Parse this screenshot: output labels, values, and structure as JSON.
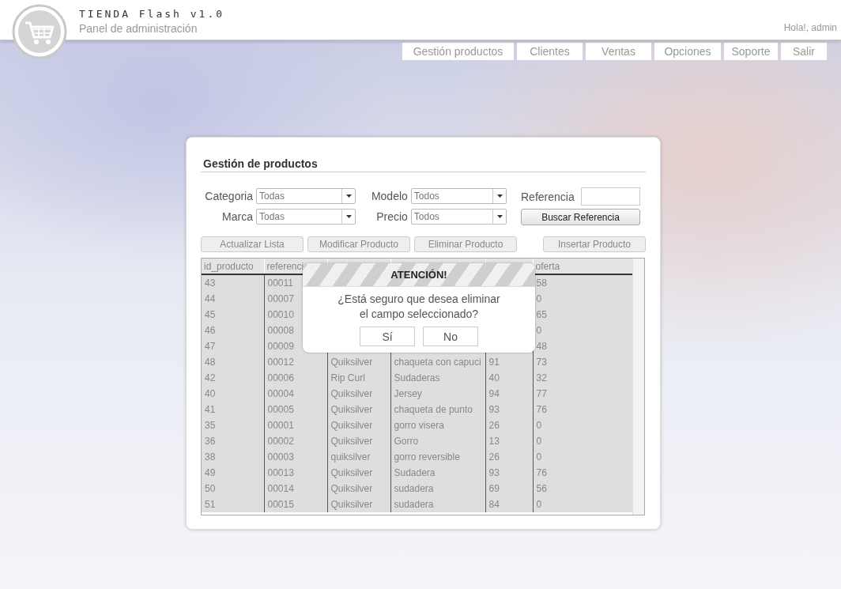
{
  "header": {
    "title": "TIENDA Flash v1.0",
    "subtitle": "Panel de administración",
    "greeting": "Hola!, admin"
  },
  "nav": [
    {
      "label": "Gestión productos"
    },
    {
      "label": "Clientes"
    },
    {
      "label": "Ventas"
    },
    {
      "label": "Opciones"
    },
    {
      "label": "Soporte"
    },
    {
      "label": "Salir"
    }
  ],
  "panel": {
    "title": "Gestión de productos",
    "filters": [
      {
        "label": "Categoria",
        "value": "Todas"
      },
      {
        "label": "Modelo",
        "value": "Todos"
      },
      {
        "label": "Marca",
        "value": "Todas"
      },
      {
        "label": "Precio",
        "value": "Todos"
      }
    ],
    "reference": {
      "label": "Referencia",
      "button": "Buscar Referencia"
    },
    "actions": [
      "Actualizar Lista",
      "Modificar Producto",
      "Eliminar Producto",
      "Insertar Producto"
    ],
    "table": {
      "columns": [
        "id_producto",
        "referenci",
        null,
        null,
        null,
        "oferta"
      ],
      "rows": [
        [
          "43",
          "00011",
          null,
          null,
          null,
          "58"
        ],
        [
          "44",
          "00007",
          null,
          null,
          null,
          "0"
        ],
        [
          "45",
          "00010",
          null,
          null,
          null,
          "65"
        ],
        [
          "46",
          "00008",
          null,
          null,
          null,
          "0"
        ],
        [
          "47",
          "00009",
          null,
          null,
          null,
          "48"
        ],
        [
          "48",
          "00012",
          "Quiksilver",
          "chaqueta con capuci",
          "91",
          "73"
        ],
        [
          "42",
          "00006",
          "Rip Curl",
          "Sudaderas",
          "40",
          "32"
        ],
        [
          "40",
          "00004",
          "Quiksilver",
          "Jersey",
          "94",
          "77"
        ],
        [
          "41",
          "00005",
          "Quiksilver",
          "chaqueta de punto",
          "93",
          "76"
        ],
        [
          "35",
          "00001",
          "Quiksilver",
          "gorro visera",
          "26",
          "0"
        ],
        [
          "36",
          "00002",
          "Quiksilver",
          "Gorro",
          "13",
          "0"
        ],
        [
          "38",
          "00003",
          "quiksilver",
          "gorro reversible",
          "26",
          "0"
        ],
        [
          "49",
          "00013",
          "Quiksilver",
          "Sudadera",
          "93",
          "76"
        ],
        [
          "50",
          "00014",
          "Quiksilver",
          "sudadera",
          "69",
          "56"
        ],
        [
          "51",
          "00015",
          "Quiksilver",
          "sudadera",
          "84",
          "0"
        ]
      ]
    }
  },
  "dialog": {
    "title": "ATENCIÓN!",
    "message": "¿Está seguro que desea eliminar\nel campo seleccionado?",
    "buttons": [
      "Sí",
      "No"
    ]
  }
}
